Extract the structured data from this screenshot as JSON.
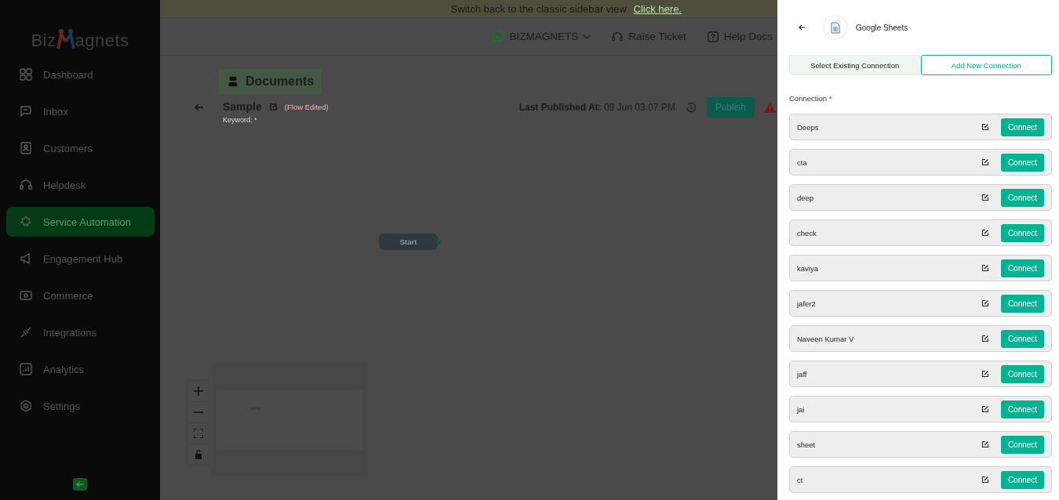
{
  "sidebar": {
    "logo": {
      "left": "Biz",
      "right": "agnets"
    },
    "items": [
      {
        "label": "Dashboard",
        "selected": false
      },
      {
        "label": "Inbox",
        "selected": false
      },
      {
        "label": "Customers",
        "selected": false
      },
      {
        "label": "Helpdesk",
        "selected": false
      },
      {
        "label": "Service Automation",
        "selected": true
      },
      {
        "label": "Engagement Hub",
        "selected": false
      },
      {
        "label": "Commerce",
        "selected": false
      },
      {
        "label": "Integrations",
        "selected": false
      },
      {
        "label": "Analytics",
        "selected": false
      },
      {
        "label": "Settings",
        "selected": false
      }
    ]
  },
  "banner": {
    "text": "Switch back to the classic sidebar view",
    "link": "Click here."
  },
  "header": {
    "account": "BIZMAGNETS",
    "raise_ticket": "Raise Ticket",
    "help_docs": "Help Docs"
  },
  "flow": {
    "folder": "Documents",
    "name": "Sample",
    "status": "(Flow Edited)",
    "keyword": "Keyword: *",
    "published_label": "Last Published At:",
    "published_value": "09 Jun 03.07 PM",
    "publish_button": "Publish",
    "start_node": "Start"
  },
  "drawer": {
    "title": "Google Sheets",
    "tabs": [
      {
        "label": "Select Existing Connection",
        "selected": true
      },
      {
        "label": "Add New Connection",
        "selected": false
      }
    ],
    "connection_label": "Connection",
    "required_mark": "*",
    "connections": [
      {
        "name": "Deeps",
        "button": "Connect"
      },
      {
        "name": "cta",
        "button": "Connect"
      },
      {
        "name": "deep",
        "button": "Connect"
      },
      {
        "name": "check",
        "button": "Connect"
      },
      {
        "name": "kaviya",
        "button": "Connect"
      },
      {
        "name": "jafer2",
        "button": "Connect"
      },
      {
        "name": "Naveen Kumar V",
        "button": "Connect"
      },
      {
        "name": "jaff",
        "button": "Connect"
      },
      {
        "name": "jai",
        "button": "Connect"
      },
      {
        "name": "sheet",
        "button": "Connect"
      },
      {
        "name": "ct",
        "button": "Connect"
      }
    ]
  }
}
